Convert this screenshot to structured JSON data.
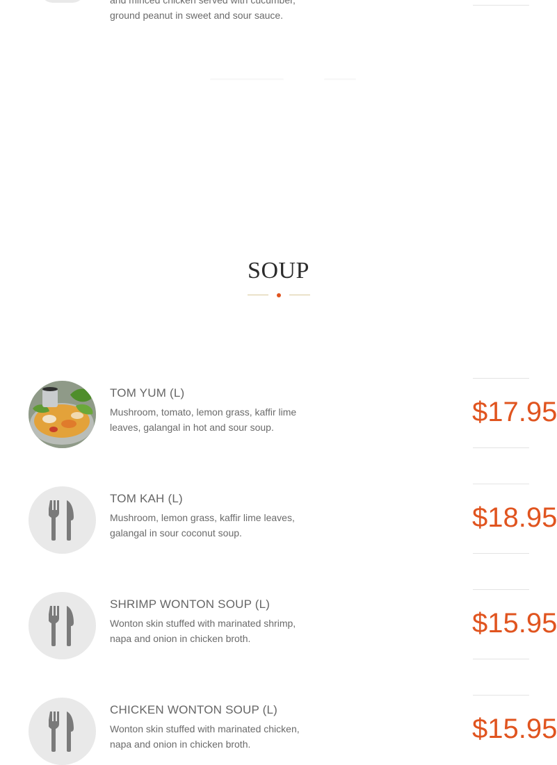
{
  "previous_item": {
    "description_line1": "and minced chicken served with cucumber,",
    "description_line2": "ground peanut in sweet and sour sauce."
  },
  "section": {
    "title": "SOUP"
  },
  "items": [
    {
      "name": "TOM YUM (L)",
      "description": "Mushroom, tomato, lemon grass, kaffir lime leaves, galangal in hot and sour soup.",
      "price": "$17.95",
      "image": "soup-photo"
    },
    {
      "name": "TOM KAH (L)",
      "description": "Mushroom, lemon grass, kaffir lime leaves, galangal in sour coconut soup.",
      "price": "$18.95",
      "image": "fork-knife-icon"
    },
    {
      "name": "SHRIMP WONTON SOUP (L)",
      "description": "Wonton skin stuffed with marinated shrimp, napa and onion in chicken broth.",
      "price": "$15.95",
      "image": "fork-knife-icon"
    },
    {
      "name": "CHICKEN WONTON SOUP (L)",
      "description": "Wonton skin stuffed with marinated chicken, napa and onion in chicken broth.",
      "price": "$15.95",
      "image": "fork-knife-icon"
    }
  ],
  "colors": {
    "accent": "#e0541f",
    "divider_gold": "#d9c89a",
    "placeholder_bg": "#e9e9e9",
    "icon_gray": "#7a7a7a"
  }
}
